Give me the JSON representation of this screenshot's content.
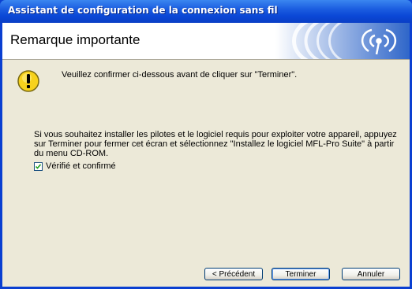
{
  "window": {
    "title": "Assistant de configuration de la connexion sans fil"
  },
  "header": {
    "title": "Remarque importante",
    "logo_icon": "wireless-signal-icon"
  },
  "warning": {
    "icon": "warning-icon",
    "text": "Veuillez confirmer ci-dessous avant de cliquer sur \"Terminer\"."
  },
  "body": {
    "text": "Si vous souhaitez installer les pilotes et le logiciel requis pour exploiter votre appareil, appuyez sur Terminer pour fermer cet écran et sélectionnez \"Installez le logiciel MFL-Pro Suite\" à partir du menu CD-ROM."
  },
  "checkbox": {
    "label": "Vérifié et confirmé",
    "checked": true
  },
  "buttons": {
    "previous": "< Précédent",
    "finish": "Terminer",
    "cancel": "Annuler"
  },
  "colors": {
    "titlebar": "#0a3fd1",
    "dialog_bg": "#ece9d8",
    "logo_blue": "#1b4fb0"
  }
}
